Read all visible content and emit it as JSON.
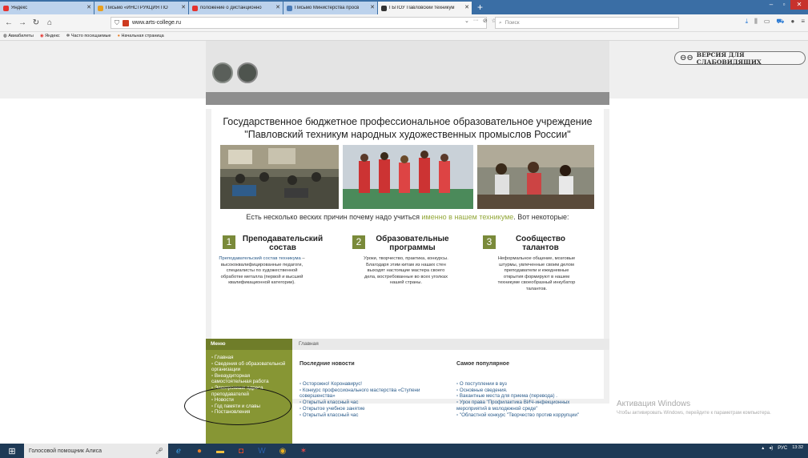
{
  "browser": {
    "tabs": [
      {
        "label": "Яндекс",
        "color": "#e5322d"
      },
      {
        "label": "Письмо «ИНСТРУКЦИЯ ПО ",
        "color": "#e8a020"
      },
      {
        "label": "положение о дистанционно",
        "color": "#e5322d"
      },
      {
        "label": "Письмо Министерства просв",
        "color": "#4a7bb7"
      },
      {
        "label": "ГБПОУ Павловский техникум",
        "color": "#333333"
      }
    ],
    "new_tab": "+",
    "url": "www.arts-college.ru",
    "search_placeholder": "Поиск",
    "bookmarks": [
      "Авиабилеты",
      "Яндекс",
      "Часто посещаемые",
      "Начальная страница"
    ]
  },
  "site": {
    "vision_button": "ВЕРСИЯ ДЛЯ СЛАБОВИДЯЩИХ",
    "title_line1": "Государственное бюджетное профессиональное образовательное учреждение",
    "title_line2": "\"Павловский техникум народных художественных промыслов России\"",
    "reasons_pre": "Есть несколько веских причин почему надо учиться ",
    "reasons_hl": "именно в нашем техникуме",
    "reasons_post": ". Вот некоторые:",
    "columns": [
      {
        "num": "1",
        "title": "Преподавательский состав",
        "text_lead": "Преподавательский состав техникума",
        "text": " – высококвалифицированные педагоги, специалисты по художественной обработке металла (первой и высшей квалификационной категории)."
      },
      {
        "num": "2",
        "title": "Образовательные программы",
        "text_lead": "",
        "text": "Уроки, творчество, практика, конкурсы. Благодаря этим китам из наших стен выходят настоящие мастера своего дела, востребованные во всех уголках нашей страны."
      },
      {
        "num": "3",
        "title": "Сообщество талантов",
        "text_lead": "",
        "text": "Неформальное общение, мозговые штурмы, увлеченные своим делом преподаватели и ежедневные открытия формируют в нашем техникуме своеобразный инкубатор талантов."
      }
    ],
    "menu_title": "Меню",
    "menu_items": [
      "Главная",
      "Сведения об образовательной организации",
      "Внеаудиторная самостоятельная работа",
      "Электронные адреса преподавателей",
      "Новости",
      "Год памяти и славы",
      "Постановления"
    ],
    "breadcrumb": "Главная",
    "latest_news_title": "Последние новости",
    "latest_news": [
      "Осторожно! Коронавирус!",
      "Конкурс профессионального мастерства «Ступени совершенства»",
      "Открытый классный час",
      "Открытое учебное занятие",
      "Открытый классный час"
    ],
    "popular_title": "Самое популярное",
    "popular": [
      "О поступлении в вуз",
      "Основные сведения.",
      "Вакантные места для приема (перевода) .",
      "Урок права \"Профилактика ВИЧ-инфекционных мероприятий в молодежной среде\"",
      "\"Областной конкурс \"Творчество против коррупции\""
    ]
  },
  "watermark": {
    "line1": "Активация Windows",
    "line2": "Чтобы активировать Windows, перейдите к параметрам компьютера."
  },
  "taskbar": {
    "assistant": "Голосовой помощник Алиса",
    "lang": "РУС",
    "time": "13:32"
  }
}
